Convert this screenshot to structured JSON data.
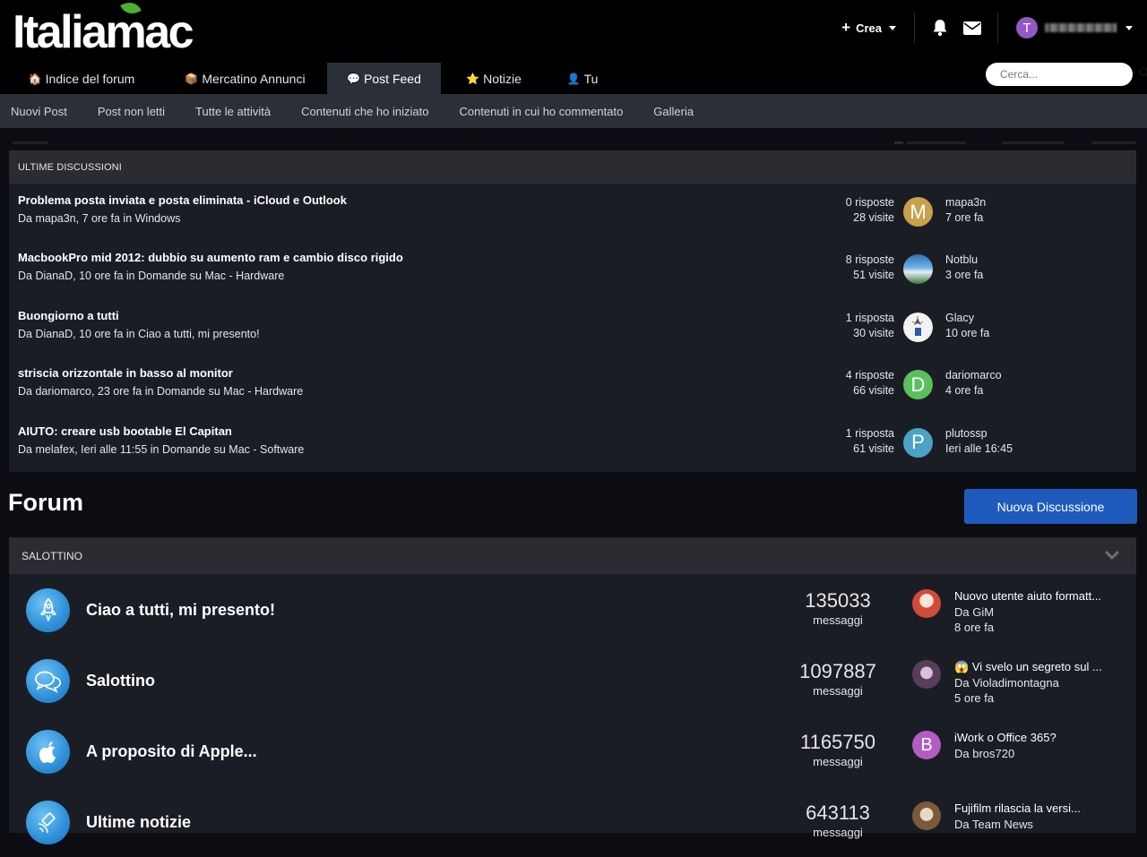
{
  "brand": {
    "logo_text": "Italiamac"
  },
  "header": {
    "crea_label": "Crea",
    "user_initial": "T",
    "search_placeholder": "Cerca..."
  },
  "tabs": [
    {
      "label": "Indice del forum",
      "icon": "house-icon",
      "emoji": "🏠"
    },
    {
      "label": "Mercatino Annunci",
      "icon": "box-icon",
      "emoji": "📦"
    },
    {
      "label": "Post Feed",
      "icon": "speech-bubble-icon",
      "emoji": "💬",
      "active": true
    },
    {
      "label": "Notizie",
      "icon": "star-icon",
      "emoji": "⭐"
    },
    {
      "label": "Tu",
      "icon": "user-icon",
      "emoji": "👤"
    }
  ],
  "subnav": [
    "Nuovi Post",
    "Post non letti",
    "Tutte le attività",
    "Contenuti che ho iniziato",
    "Contenuti in cui ho commentato",
    "Galleria"
  ],
  "recent": {
    "heading": "ULTIME DISCUSSIONI",
    "items": [
      {
        "title": "Problema posta inviata e posta eliminata - iCloud e Outlook",
        "meta": "Da mapa3n, 7 ore fa in Windows",
        "replies": "0 risposte",
        "views": "28 visite",
        "user": "mapa3n",
        "when": "7 ore fa",
        "avatar_letter": "M",
        "avatar_color": "#c9a04e"
      },
      {
        "title": "MacbookPro mid 2012: dubbio su aumento ram e cambio disco rigido",
        "meta": "Da DianaD, 10 ore fa in Domande su Mac - Hardware",
        "replies": "8 risposte",
        "views": "51 visite",
        "user": "Notblu",
        "when": "3 ore fa",
        "avatar_letter": "",
        "avatar_color": "#3c7fbf"
      },
      {
        "title": "Buongiorno a tutti",
        "meta": "Da DianaD, 10 ore fa in Ciao a tutti, mi presento!",
        "replies": "1 risposta",
        "views": "30 visite",
        "user": "Glacy",
        "when": "10 ore fa",
        "avatar_letter": "",
        "avatar_color": "#f2f2f2"
      },
      {
        "title": "striscia orizzontale in basso al monitor",
        "meta": "Da dariomarco, 23 ore fa in Domande su Mac - Hardware",
        "replies": "4 risposte",
        "views": "66 visite",
        "user": "dariomarco",
        "when": "4 ore fa",
        "avatar_letter": "D",
        "avatar_color": "#5bbf5e"
      },
      {
        "title": "AIUTO: creare usb bootable El Capitan",
        "meta": "Da melafex, Ieri alle 11:55 in Domande su Mac - Software",
        "replies": "1 risposta",
        "views": "61 visite",
        "user": "plutossp",
        "when": "Ieri alle 16:45",
        "avatar_letter": "P",
        "avatar_color": "#4aa3c4"
      }
    ]
  },
  "forum": {
    "title": "Forum",
    "new_button": "Nuova Discussione",
    "category": "SALOTTINO",
    "boards": [
      {
        "name": "Ciao a tutti, mi presento!",
        "icon": "rocket-icon",
        "count": "135033",
        "count_label": "messaggi",
        "last_title": "Nuovo utente aiuto formatt...",
        "last_by": "Da GiM",
        "last_when": "8 ore fa",
        "avatar_letter": "",
        "avatar_color": "#d24a3a"
      },
      {
        "name": "Salottino",
        "icon": "chat-bubbles-icon",
        "count": "1097887",
        "count_label": "messaggi",
        "last_title": "😱 Vi svelo un segreto sul ...",
        "last_by": "Da Violadimontagna",
        "last_when": "5 ore fa",
        "avatar_letter": "",
        "avatar_color": "#7a5a7a"
      },
      {
        "name": "A proposito di Apple...",
        "icon": "apple-icon",
        "count": "1165750",
        "count_label": "messaggi",
        "last_title": "iWork o Office 365?",
        "last_by": "Da bros720",
        "last_when": "",
        "avatar_letter": "B",
        "avatar_color": "#b35cc4"
      },
      {
        "name": "Ultime notizie",
        "icon": "satellite-icon",
        "count": "643113",
        "count_label": "messaggi",
        "last_title": "Fujifilm rilascia la versi...",
        "last_by": "Da Team News",
        "last_when": "",
        "avatar_letter": "",
        "avatar_color": "#8a6a4a"
      }
    ]
  }
}
